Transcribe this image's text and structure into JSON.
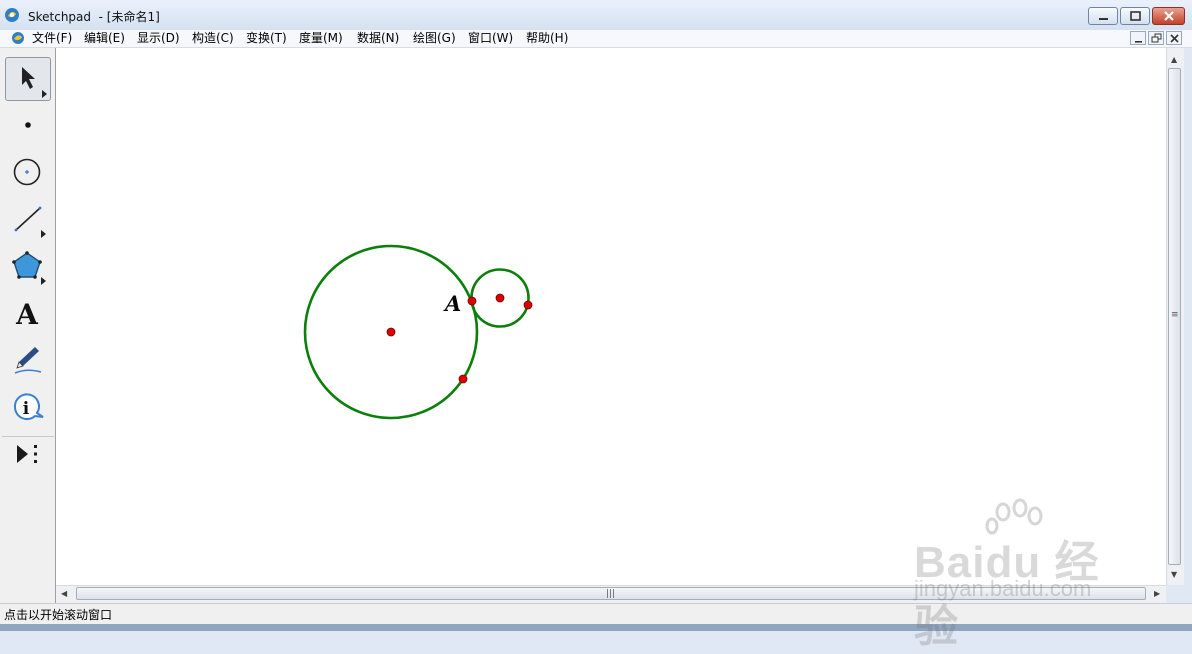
{
  "window": {
    "title": "Sketchpad  - [未命名1]"
  },
  "menu": {
    "items": [
      "文件(F)",
      "编辑(E)",
      "显示(D)",
      "构造(C)",
      "变换(T)",
      "度量(M)",
      "数据(N)",
      "绘图(G)",
      "窗口(W)",
      "帮助(H)"
    ]
  },
  "toolbox": {
    "tools": [
      {
        "name": "selection-arrow-tool",
        "icon": "arrow-pointer-icon",
        "selected": true
      },
      {
        "name": "point-tool",
        "icon": "point-icon"
      },
      {
        "name": "compass-tool",
        "icon": "circle-compass-icon"
      },
      {
        "name": "straightedge-tool",
        "icon": "line-segment-icon"
      },
      {
        "name": "polygon-tool",
        "icon": "pentagon-icon"
      },
      {
        "name": "text-tool",
        "icon": "letter-a-icon",
        "glyph": "A"
      },
      {
        "name": "marker-tool",
        "icon": "pen-marker-icon"
      },
      {
        "name": "information-tool",
        "icon": "info-icon",
        "glyph": "i"
      },
      {
        "name": "custom-tools",
        "icon": "custom-tools-icon"
      }
    ]
  },
  "canvas": {
    "point_label": "A",
    "stroke_color": "#0a7f0a",
    "point_color": "#dd0000"
  },
  "status": {
    "text": "点击以开始滚动窗口"
  },
  "watermark": {
    "main": "Baidu 经验",
    "sub": "jingyan.baidu.com"
  }
}
